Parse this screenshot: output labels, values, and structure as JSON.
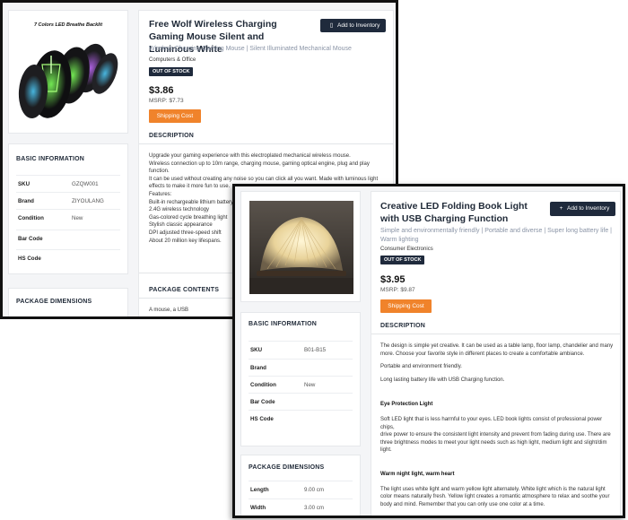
{
  "back": {
    "product": {
      "title": "Free Wolf Wireless Charging Gaming Mouse Silent and Luminous White",
      "subtitle": "Wireless Charging Gaming Mouse | Silent Illuminated Mechanical Mouse",
      "category": "Computers & Office",
      "stock_badge": "OUT OF STOCK",
      "price": "$3.86",
      "msrp": "MSRP: $7.73",
      "shipping_label": "Shipping Cost",
      "inventory_label": "Add to Inventory",
      "image_caption": "7 Colors LED Breathe Backlit"
    },
    "description": {
      "heading": "DESCRIPTION",
      "lines": [
        "Upgrade your gaming experience with this electroplated mechanical wireless mouse.",
        "Wireless connection up to 10m range, charging mouse, gaming optical engine, plug and play",
        "function.",
        "It can be used without creating any noise so you can click all you want. Made with luminous light",
        "effects to make it more fun to use.",
        "Features:",
        "Built-in rechargeable lithium battery",
        "2.4G wireless technology",
        "Gas-colored cycle breathing light",
        "Stylish classic appearance",
        "DPI adjusted three-speed shift",
        "About 20 million key lifespans."
      ]
    },
    "basic_info": {
      "heading": "BASIC INFORMATION",
      "rows": [
        {
          "label": "SKU",
          "value": "GZQW001"
        },
        {
          "label": "Brand",
          "value": "ZIYOULANG"
        },
        {
          "label": "Condition",
          "value": "New"
        },
        {
          "label": "Bar Code",
          "value": ""
        },
        {
          "label": "HS Code",
          "value": ""
        }
      ]
    },
    "package_dimensions": {
      "heading": "PACKAGE DIMENSIONS"
    },
    "package_contents": {
      "heading": "PACKAGE CONTENTS",
      "text": "A mouse, a USB"
    }
  },
  "front": {
    "product": {
      "title": "Creative LED Folding Book Light with USB Charging Function",
      "subtitle": "Simple and environmentally friendly | Portable and diverse | Super long battery life | Warm lighting",
      "category": "Consumer Electronics",
      "stock_badge": "OUT OF STOCK",
      "price": "$3.95",
      "msrp": "MSRP: $9.87",
      "shipping_label": "Shipping Cost",
      "inventory_label": "Add to Inventory"
    },
    "description": {
      "heading": "DESCRIPTION",
      "para1": [
        "The design is simple yet creative. It can be used as a table lamp, floor lamp, chandelier and many",
        "more. Choose your favorite style in different places to create a comfortable ambiance."
      ],
      "para2": "Portable and environment friendly.",
      "para3": "Long lasting battery life with USB Charging function.",
      "eye_heading": "Eye Protection Light",
      "eye_text": [
        "Soft LED light that is less harmful to your eyes. LED book lights consist of professional power chips,",
        "drive power to ensure the consistent light intensity and prevent from fading during use. There are",
        "three brightness modes to meet your light needs such as high light, medium light and slight/dim",
        "light."
      ],
      "warm_heading": "Warm night light, warm heart",
      "warm_text": [
        "The light uses white light and warm yellow light alternately. White light which is the natural light",
        "color means naturally fresh. Yellow light creates a romantic atmosphere to relax and soothe your",
        "body and mind. Remember that you can only use one color at a time."
      ]
    },
    "basic_info": {
      "heading": "BASIC INFORMATION",
      "rows": [
        {
          "label": "SKU",
          "value": "B01-B15"
        },
        {
          "label": "Brand",
          "value": ""
        },
        {
          "label": "Condition",
          "value": "New"
        },
        {
          "label": "Bar Code",
          "value": ""
        },
        {
          "label": "HS Code",
          "value": ""
        }
      ]
    },
    "package_dimensions": {
      "heading": "PACKAGE DIMENSIONS",
      "rows": [
        {
          "label": "Length",
          "value": "9.00 cm"
        },
        {
          "label": "Width",
          "value": "3.00 cm"
        }
      ]
    }
  },
  "colors": {
    "accent_orange": "#f0832b",
    "navy": "#1f2a3c",
    "subtitle_gray": "#8a94a6"
  },
  "icons": {
    "inventory_back": "calendar-icon",
    "inventory_front": "plus-icon"
  }
}
